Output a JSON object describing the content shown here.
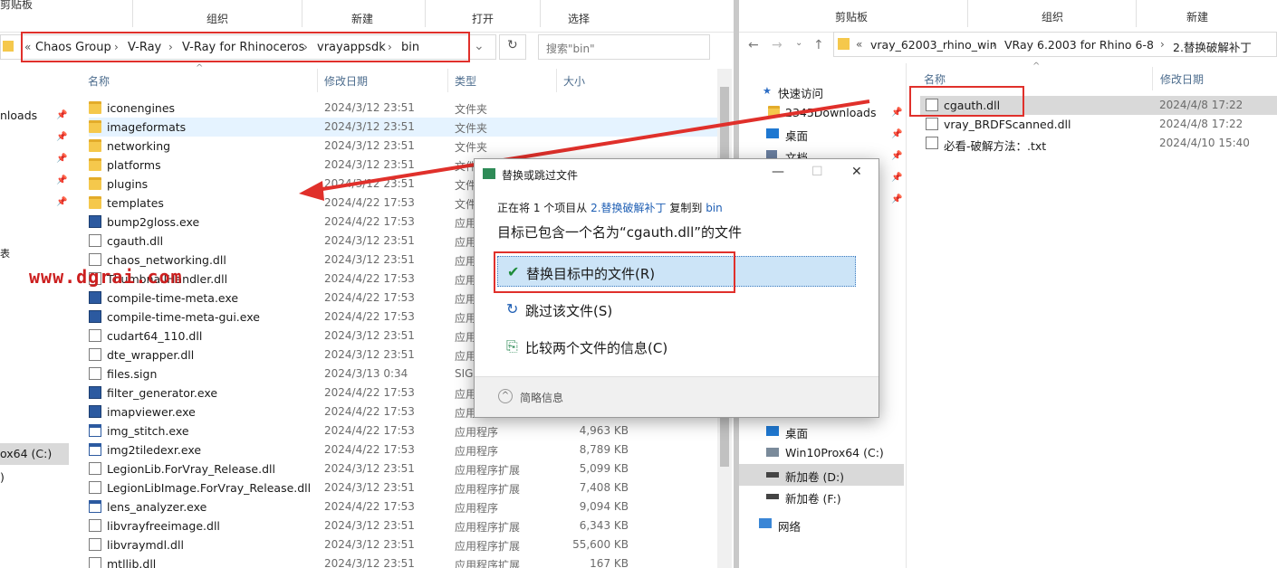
{
  "left": {
    "ribbon": [
      "剪贴板",
      "组织",
      "新建",
      "打开",
      "选择"
    ],
    "breadcrumb": [
      "Chaos Group",
      "V-Ray",
      "V-Ray for Rhinoceros",
      "vrayappsdk",
      "bin"
    ],
    "breadcrumb_prefix": "«",
    "search_placeholder": "搜索\"bin\"",
    "columns": {
      "name": "名称",
      "date": "修改日期",
      "type": "类型",
      "size": "大小"
    },
    "nav": {
      "downloads": "nloads",
      "drive_c": "ox64 (C:)",
      "paren": ")",
      "misc": "表"
    },
    "files": [
      {
        "name": "iconengines",
        "date": "2024/3/12 23:51",
        "type": "文件夹",
        "size": "",
        "icon": "folder"
      },
      {
        "name": "imageformats",
        "date": "2024/3/12 23:51",
        "type": "文件夹",
        "size": "",
        "icon": "folder"
      },
      {
        "name": "networking",
        "date": "2024/3/12 23:51",
        "type": "文件夹",
        "size": "",
        "icon": "folder"
      },
      {
        "name": "platforms",
        "date": "2024/3/12 23:51",
        "type": "文件夹",
        "size": "",
        "icon": "folder"
      },
      {
        "name": "plugins",
        "date": "2024/3/12 23:51",
        "type": "文件夹",
        "size": "",
        "icon": "folder"
      },
      {
        "name": "templates",
        "date": "2024/4/22 17:53",
        "type": "文件",
        "size": "",
        "icon": "folder"
      },
      {
        "name": "bump2gloss.exe",
        "date": "2024/4/22 17:53",
        "type": "应用",
        "size": "",
        "icon": "exe"
      },
      {
        "name": "cgauth.dll",
        "date": "2024/3/12 23:51",
        "type": "应用",
        "size": "",
        "icon": "file"
      },
      {
        "name": "chaos_networking.dll",
        "date": "2024/3/12 23:51",
        "type": "应用",
        "size": "",
        "icon": "file"
      },
      {
        "name": "ThumbnailHandler.dll",
        "date": "2024/4/22 17:53",
        "type": "应用",
        "size": "",
        "icon": "file"
      },
      {
        "name": "compile-time-meta.exe",
        "date": "2024/4/22 17:53",
        "type": "应用",
        "size": "",
        "icon": "exe"
      },
      {
        "name": "compile-time-meta-gui.exe",
        "date": "2024/4/22 17:53",
        "type": "应用",
        "size": "",
        "icon": "exe"
      },
      {
        "name": "cudart64_110.dll",
        "date": "2024/3/12 23:51",
        "type": "应用",
        "size": "",
        "icon": "file"
      },
      {
        "name": "dte_wrapper.dll",
        "date": "2024/3/12 23:51",
        "type": "应用",
        "size": "",
        "icon": "file"
      },
      {
        "name": "files.sign",
        "date": "2024/3/13 0:34",
        "type": "SIG",
        "size": "",
        "icon": "blank"
      },
      {
        "name": "filter_generator.exe",
        "date": "2024/4/22 17:53",
        "type": "应用",
        "size": "",
        "icon": "exe"
      },
      {
        "name": "imapviewer.exe",
        "date": "2024/4/22 17:53",
        "type": "应用",
        "size": "",
        "icon": "exe"
      },
      {
        "name": "img_stitch.exe",
        "date": "2024/4/22 17:53",
        "type": "应用程序",
        "size": "4,963 KB",
        "icon": "exe2"
      },
      {
        "name": "img2tiledexr.exe",
        "date": "2024/4/22 17:53",
        "type": "应用程序",
        "size": "8,789 KB",
        "icon": "exe2"
      },
      {
        "name": "LegionLib.ForVray_Release.dll",
        "date": "2024/3/12 23:51",
        "type": "应用程序扩展",
        "size": "5,099 KB",
        "icon": "file"
      },
      {
        "name": "LegionLibImage.ForVray_Release.dll",
        "date": "2024/3/12 23:51",
        "type": "应用程序扩展",
        "size": "7,408 KB",
        "icon": "file"
      },
      {
        "name": "lens_analyzer.exe",
        "date": "2024/4/22 17:53",
        "type": "应用程序",
        "size": "9,094 KB",
        "icon": "exe2"
      },
      {
        "name": "libvrayfreeimage.dll",
        "date": "2024/3/12 23:51",
        "type": "应用程序扩展",
        "size": "6,343 KB",
        "icon": "file"
      },
      {
        "name": "libvraymdl.dll",
        "date": "2024/3/12 23:51",
        "type": "应用程序扩展",
        "size": "55,600 KB",
        "icon": "file"
      },
      {
        "name": "mtllib.dll",
        "date": "2024/3/12 23:51",
        "type": "应用程序扩展",
        "size": "167 KB",
        "icon": "file"
      }
    ]
  },
  "right": {
    "ribbon": [
      "剪贴板",
      "组织",
      "新建"
    ],
    "breadcrumb_prefix": "«",
    "breadcrumb": [
      "vray_62003_rhino_win",
      "VRay 6.2003 for Rhino 6-8",
      "2.替换破解补丁"
    ],
    "columns": {
      "name": "名称",
      "date": "修改日期"
    },
    "nav": [
      "快速访问",
      "2345Downloads",
      "桌面",
      "文档",
      "桌面",
      "Win10Prox64 (C:)",
      "新加卷 (D:)",
      "新加卷 (F:)",
      "网络"
    ],
    "files": [
      {
        "name": "cgauth.dll",
        "date": "2024/4/8 17:22"
      },
      {
        "name": "vray_BRDFScanned.dll",
        "date": "2024/4/8 17:22"
      },
      {
        "name": "必看-破解方法：.txt",
        "date": "2024/4/10 15:40"
      }
    ]
  },
  "watermark": "www.dgrai.com",
  "dialog": {
    "title": "替换或跳过文件",
    "line1_a": "正在将 1 个项目从 ",
    "line1_src": "2.替换破解补丁",
    "line1_b": " 复制到 ",
    "line1_dst": "bin",
    "heading": "目标已包含一个名为“cgauth.dll”的文件",
    "opt_replace": "替换目标中的文件(R)",
    "opt_skip": "跳过该文件(S)",
    "opt_compare": "比较两个文件的信息(C)",
    "details": "简略信息"
  },
  "colors": {
    "highlight": "#e0302b",
    "accent": "#1f5fb4",
    "selected": "#cce4f7"
  }
}
